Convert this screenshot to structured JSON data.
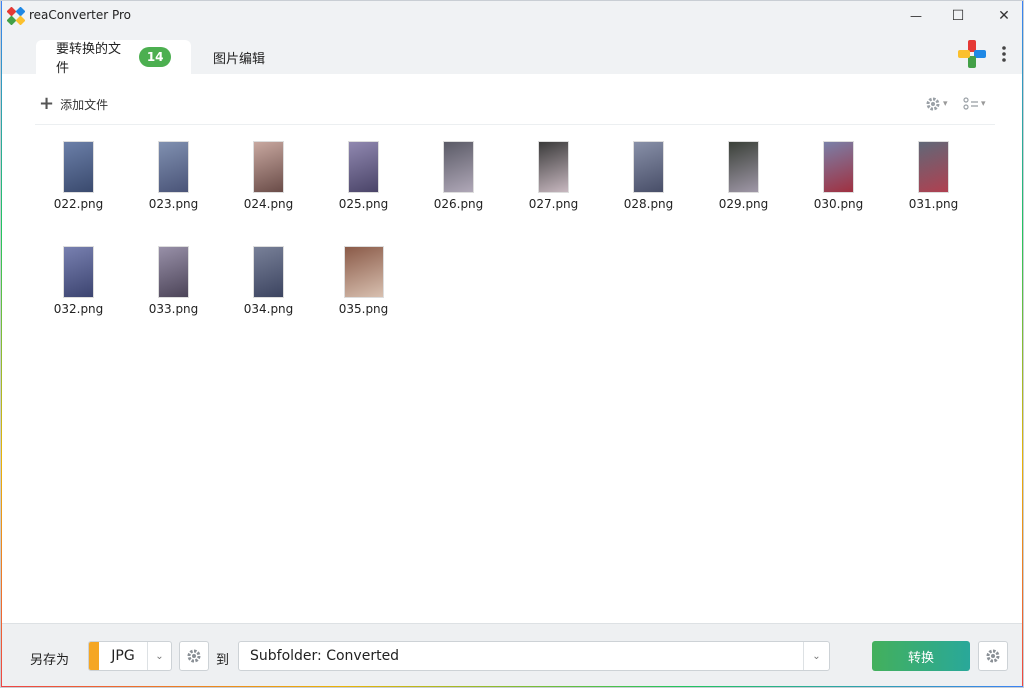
{
  "window": {
    "title": "reaConverter Pro",
    "controls": {
      "minimize": "—",
      "maximize": "☐",
      "close": "✕"
    }
  },
  "tabs": [
    {
      "label": "要转换的文件",
      "badge": "14",
      "active": true
    },
    {
      "label": "图片编辑",
      "active": false
    }
  ],
  "toolbar": {
    "add_file_label": "添加文件",
    "add_icon": "plus-icon",
    "settings_icon": "gear-icon",
    "view_icon": "list-view-icon"
  },
  "files": [
    {
      "name": "022.png",
      "colors": [
        "#6b7fa8",
        "#3a4a6e"
      ]
    },
    {
      "name": "023.png",
      "colors": [
        "#8090b0",
        "#4a5478"
      ]
    },
    {
      "name": "024.png",
      "colors": [
        "#c8a8a0",
        "#6a4c48"
      ]
    },
    {
      "name": "025.png",
      "colors": [
        "#9088b0",
        "#4a4468"
      ]
    },
    {
      "name": "026.png",
      "colors": [
        "#5a5a66",
        "#b0a8b8"
      ]
    },
    {
      "name": "027.png",
      "colors": [
        "#3a3a3a",
        "#c8b8c0"
      ]
    },
    {
      "name": "028.png",
      "colors": [
        "#8890a8",
        "#484e68"
      ]
    },
    {
      "name": "029.png",
      "colors": [
        "#3a4038",
        "#a098a8"
      ]
    },
    {
      "name": "030.png",
      "colors": [
        "#7a80a8",
        "#a03040"
      ]
    },
    {
      "name": "031.png",
      "colors": [
        "#606878",
        "#b04050"
      ]
    },
    {
      "name": "032.png",
      "colors": [
        "#7880b0",
        "#3c4470"
      ]
    },
    {
      "name": "033.png",
      "colors": [
        "#9890a8",
        "#4c4458"
      ]
    },
    {
      "name": "034.png",
      "colors": [
        "#788098",
        "#3c4460"
      ]
    },
    {
      "name": "035.png",
      "colors": [
        "#8a5a48",
        "#d8c0b0"
      ],
      "wide": true
    }
  ],
  "bottom": {
    "save_as_label": "另存为",
    "format_value": "JPG",
    "to_label": "到",
    "destination_value": "Subfolder: Converted",
    "convert_label": "转换"
  },
  "colors": {
    "badge": "#4caf50",
    "format_accent": "#f5a623",
    "convert_start": "#43b05c",
    "convert_end": "#29a89a"
  }
}
